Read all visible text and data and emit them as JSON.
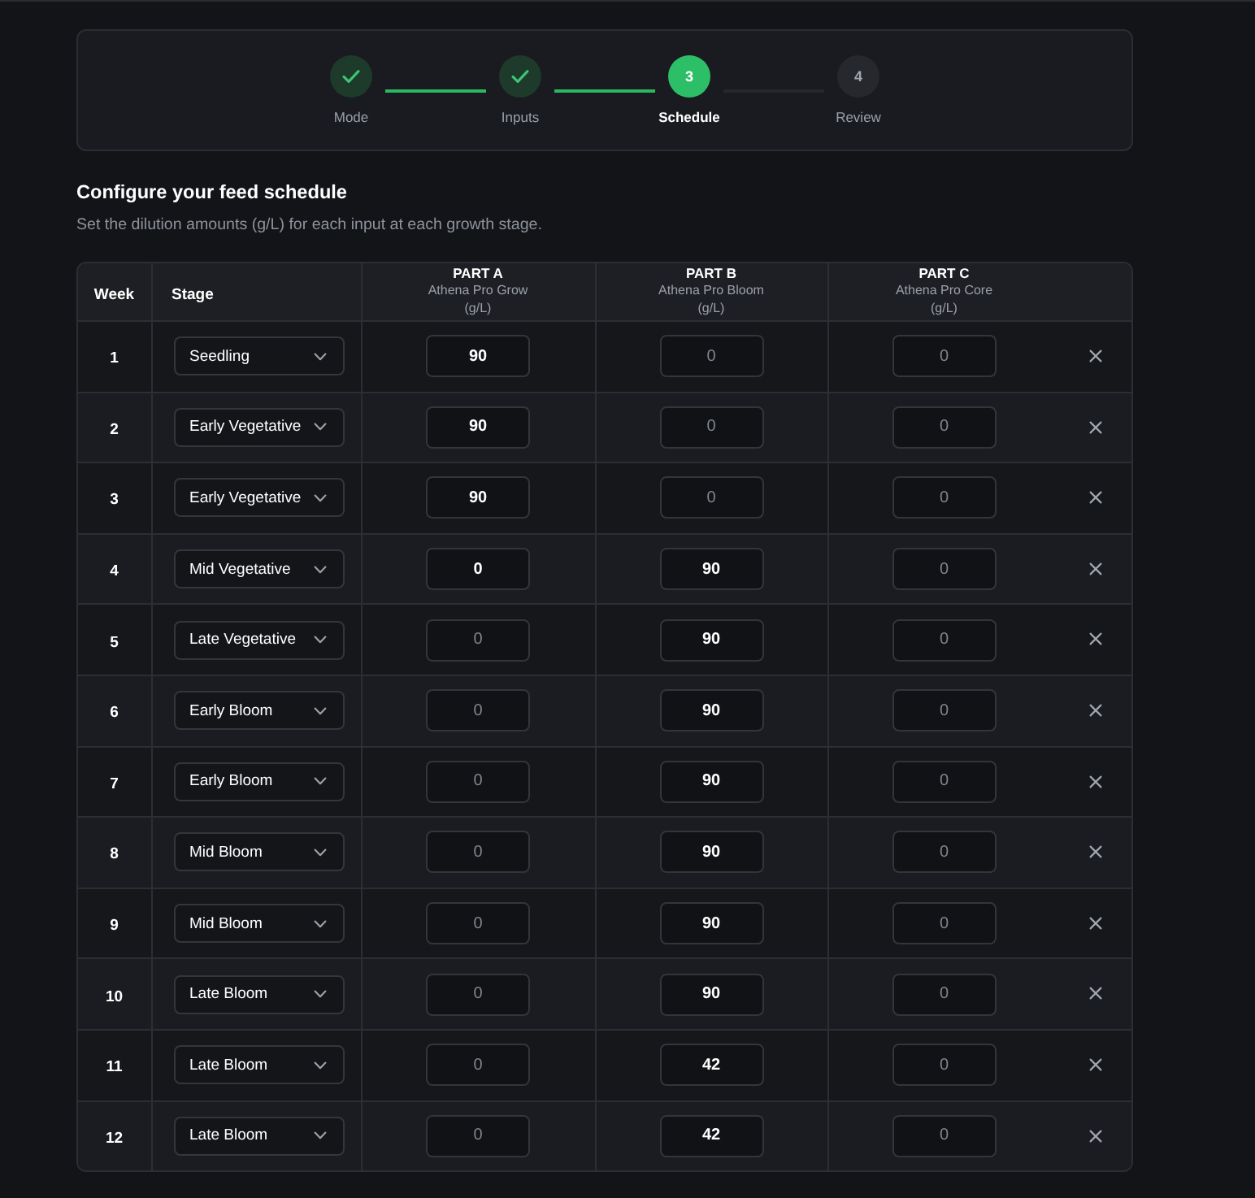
{
  "stepper": {
    "steps": [
      {
        "label": "Mode",
        "completed": true,
        "selected": false
      },
      {
        "label": "Inputs",
        "completed": true,
        "selected": false
      },
      {
        "label": "Schedule",
        "completed": false,
        "selected": true,
        "number": "3"
      },
      {
        "label": "Review",
        "completed": false,
        "selected": false,
        "number": "4"
      }
    ]
  },
  "heading": "Configure your feed schedule",
  "description": "Set the dilution amounts (g/L) for each input at each growth stage.",
  "table": {
    "columns": [
      {
        "title": "Week"
      },
      {
        "title": "Stage"
      },
      {
        "title": "PART A",
        "subtitle": "Athena Pro Grow",
        "unit": "(g/L)"
      },
      {
        "title": "PART B",
        "subtitle": "Athena Pro Bloom",
        "unit": "(g/L)"
      },
      {
        "title": "PART C",
        "subtitle": "Athena Pro Core",
        "unit": "(g/L)"
      }
    ],
    "rows": [
      {
        "week": "1",
        "stage": "Seedling",
        "amounts": [
          {
            "value": "90"
          },
          {
            "placeholder": "0"
          },
          {
            "placeholder": "0"
          }
        ]
      },
      {
        "week": "2",
        "stage": "Early Vegetative",
        "amounts": [
          {
            "value": "90"
          },
          {
            "placeholder": "0"
          },
          {
            "placeholder": "0"
          }
        ]
      },
      {
        "week": "3",
        "stage": "Early Vegetative",
        "amounts": [
          {
            "value": "90"
          },
          {
            "placeholder": "0"
          },
          {
            "placeholder": "0"
          }
        ]
      },
      {
        "week": "4",
        "stage": "Mid Vegetative",
        "amounts": [
          {
            "value": "0"
          },
          {
            "value": "90"
          },
          {
            "placeholder": "0"
          }
        ]
      },
      {
        "week": "5",
        "stage": "Late Vegetative",
        "amounts": [
          {
            "placeholder": "0"
          },
          {
            "value": "90"
          },
          {
            "placeholder": "0"
          }
        ]
      },
      {
        "week": "6",
        "stage": "Early Bloom",
        "amounts": [
          {
            "placeholder": "0"
          },
          {
            "value": "90"
          },
          {
            "placeholder": "0"
          }
        ]
      },
      {
        "week": "7",
        "stage": "Early Bloom",
        "amounts": [
          {
            "placeholder": "0"
          },
          {
            "value": "90"
          },
          {
            "placeholder": "0"
          }
        ]
      },
      {
        "week": "8",
        "stage": "Mid Bloom",
        "amounts": [
          {
            "placeholder": "0"
          },
          {
            "value": "90"
          },
          {
            "placeholder": "0"
          }
        ]
      },
      {
        "week": "9",
        "stage": "Mid Bloom",
        "amounts": [
          {
            "placeholder": "0"
          },
          {
            "value": "90"
          },
          {
            "placeholder": "0"
          }
        ]
      },
      {
        "week": "10",
        "stage": "Late Bloom",
        "amounts": [
          {
            "placeholder": "0"
          },
          {
            "value": "90"
          },
          {
            "placeholder": "0"
          }
        ]
      },
      {
        "week": "11",
        "stage": "Late Bloom",
        "amounts": [
          {
            "placeholder": "0"
          },
          {
            "value": "42"
          },
          {
            "placeholder": "0"
          }
        ]
      },
      {
        "week": "12",
        "stage": "Late Bloom",
        "amounts": [
          {
            "placeholder": "0"
          },
          {
            "value": "42"
          },
          {
            "placeholder": "0"
          }
        ]
      }
    ]
  }
}
